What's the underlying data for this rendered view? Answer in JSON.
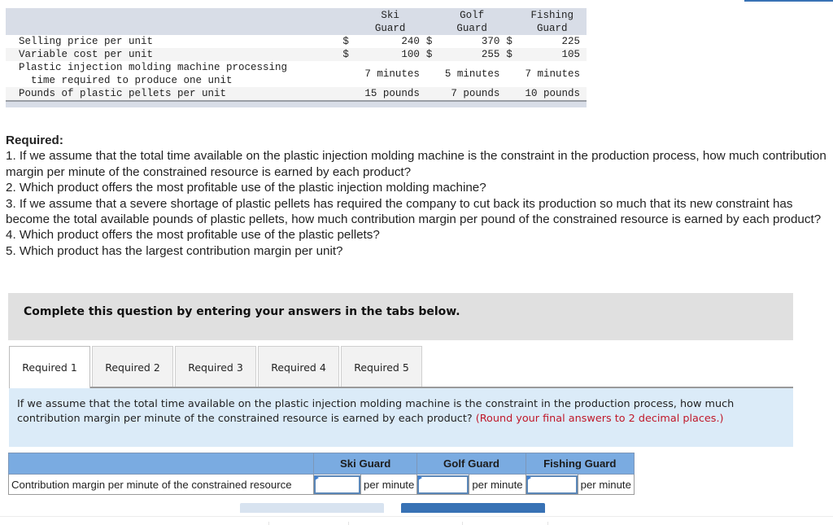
{
  "data_table": {
    "columns": [
      {
        "line1": "Ski",
        "line2": "Guard"
      },
      {
        "line1": "Golf",
        "line2": "Guard"
      },
      {
        "line1": "Fishing",
        "line2": "Guard"
      }
    ],
    "rows": [
      {
        "label": "Selling price per unit",
        "currency": "$",
        "values": [
          "240",
          "370",
          "225"
        ]
      },
      {
        "label": "Variable cost per unit",
        "currency": "$",
        "values": [
          "100",
          "255",
          "105"
        ]
      },
      {
        "label_line1": "Plastic injection molding machine processing",
        "label_line2": "  time required to produce one unit",
        "values": [
          "7 minutes",
          "5 minutes",
          "7 minutes"
        ]
      },
      {
        "label": "Pounds of plastic pellets per unit",
        "values": [
          "15 pounds",
          "7 pounds",
          "10 pounds"
        ]
      }
    ]
  },
  "required": {
    "title": "Required:",
    "items": [
      "1. If we assume that the total time available on the plastic injection molding machine is the constraint in the production process, how much contribution margin per minute of the constrained resource is earned by each product?",
      "2. Which product offers the most profitable use of the plastic injection molding machine?",
      "3. If we assume that a severe shortage of plastic pellets has required the company to cut back its production so much that its new constraint has become the total available pounds of plastic pellets, how much contribution margin per pound of the constrained resource is earned by each product?",
      "4. Which product offers the most profitable use of the plastic pellets?",
      "5. Which product has the largest contribution margin per unit?"
    ]
  },
  "instruction": "Complete this question by entering your answers in the tabs below.",
  "tabs": [
    {
      "label": "Required 1",
      "active": true
    },
    {
      "label": "Required 2",
      "active": false
    },
    {
      "label": "Required 3",
      "active": false
    },
    {
      "label": "Required 4",
      "active": false
    },
    {
      "label": "Required 5",
      "active": false
    }
  ],
  "question": {
    "text": "If we assume that the total time available on the plastic injection molding machine is the constraint in the production process, how much contribution margin per minute of the constrained resource is earned by each product?",
    "hint": "(Round your final answers to 2 decimal places.)",
    "hint_color": "#c0182a"
  },
  "answer_table": {
    "headers": [
      "Ski Guard",
      "Golf Guard",
      "Fishing Guard"
    ],
    "row_label": "Contribution margin per minute of the constrained resource",
    "unit": "per minute",
    "inputs": [
      "",
      "",
      ""
    ],
    "header_color": "#7aabe1"
  },
  "colors": {
    "accent": "#3872b5",
    "question_bg": "#dbebf8",
    "instruction_bg": "#e0e0e0"
  }
}
